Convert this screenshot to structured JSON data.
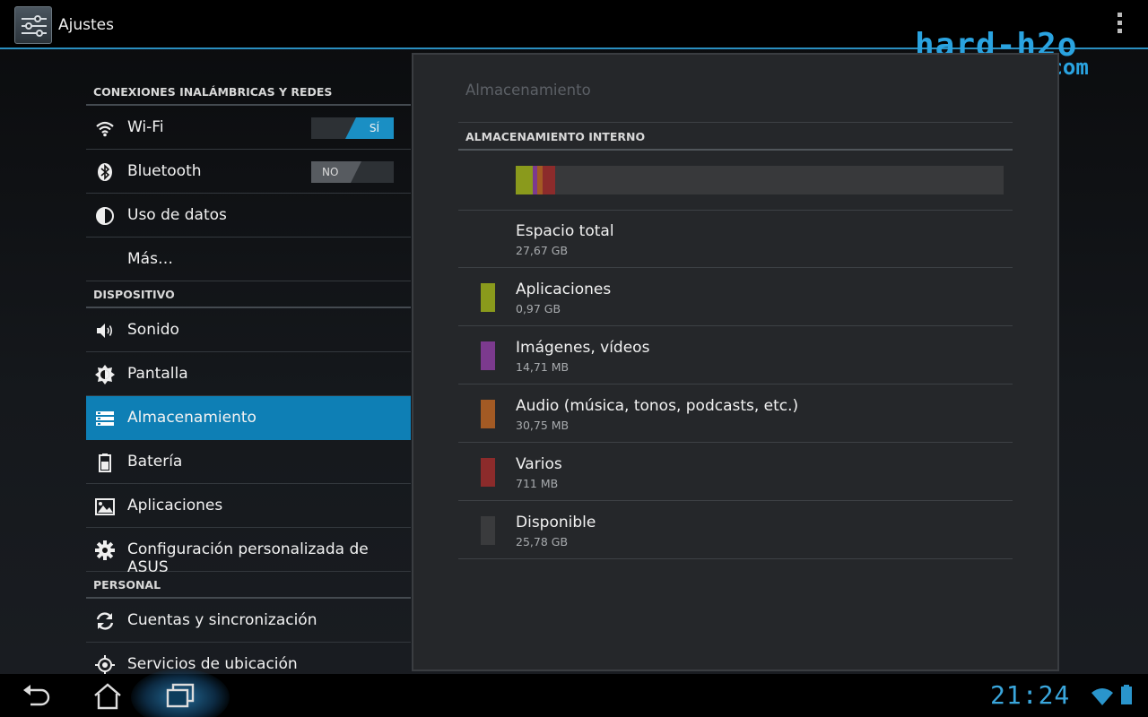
{
  "actionbar": {
    "title": "Ajustes",
    "icon": "settings-sliders-icon",
    "overflow_icon": "overflow-menu-icon"
  },
  "watermark": {
    "line1": "hard-h2o",
    "line2": ".com"
  },
  "sidebar": {
    "sections": [
      {
        "header": "CONEXIONES INALÁMBRICAS Y REDES",
        "items": [
          {
            "label": "Wi-Fi",
            "icon": "wifi-icon",
            "toggle": "SÍ",
            "toggle_state": "on"
          },
          {
            "label": "Bluetooth",
            "icon": "bluetooth-icon",
            "toggle": "NO",
            "toggle_state": "off"
          },
          {
            "label": "Uso de datos",
            "icon": "data-usage-icon"
          },
          {
            "label": "Más…",
            "icon": ""
          }
        ]
      },
      {
        "header": "DISPOSITIVO",
        "items": [
          {
            "label": "Sonido",
            "icon": "speaker-icon"
          },
          {
            "label": "Pantalla",
            "icon": "brightness-icon"
          },
          {
            "label": "Almacenamiento",
            "icon": "storage-icon",
            "selected": true
          },
          {
            "label": "Batería",
            "icon": "battery-icon"
          },
          {
            "label": "Aplicaciones",
            "icon": "apps-icon"
          },
          {
            "label": "Configuración personalizada de ASUS",
            "icon": "gear-icon"
          }
        ]
      },
      {
        "header": "PERSONAL",
        "items": [
          {
            "label": "Cuentas y sincronización",
            "icon": "sync-icon"
          },
          {
            "label": "Servicios de ubicación",
            "icon": "location-icon"
          }
        ]
      }
    ]
  },
  "panel": {
    "title": "Almacenamiento",
    "section_header": "ALMACENAMIENTO INTERNO",
    "usage_fractions": {
      "apps": 0.035,
      "images": 0.009,
      "audio": 0.011,
      "misc": 0.026,
      "free": 0.919
    },
    "rows": [
      {
        "title": "Espacio total",
        "value": "27,67 GB",
        "color": ""
      },
      {
        "title": "Aplicaciones",
        "value": "0,97 GB",
        "color": "#8a9a1c"
      },
      {
        "title": "Imágenes, vídeos",
        "value": "14,71 MB",
        "color": "#7c3a8e"
      },
      {
        "title": "Audio (música, tonos, podcasts, etc.)",
        "value": "30,75 MB",
        "color": "#a35a24"
      },
      {
        "title": "Varios",
        "value": "711 MB",
        "color": "#8c2b2b"
      },
      {
        "title": "Disponible",
        "value": "25,78 GB",
        "color": "#3a3b3d"
      }
    ]
  },
  "navbar": {
    "back_icon": "back-icon",
    "home_icon": "home-icon",
    "recents_icon": "recent-apps-icon",
    "clock": "21:24"
  }
}
